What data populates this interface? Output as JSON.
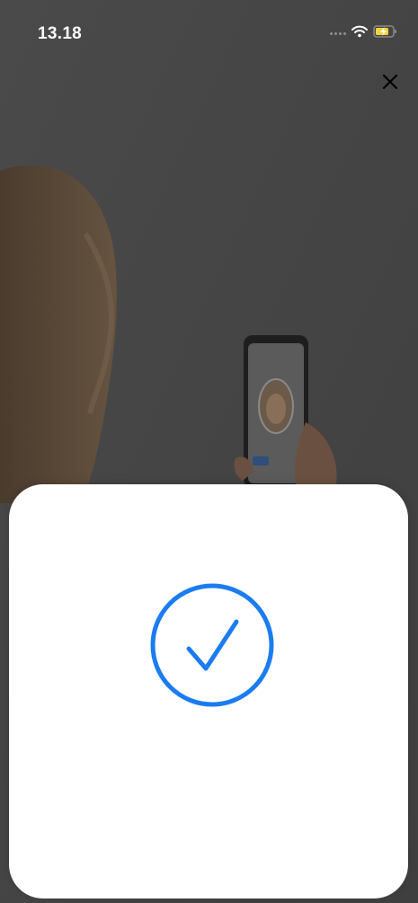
{
  "status_bar": {
    "time": "13.18"
  },
  "icons": {
    "wifi": "wifi-icon",
    "battery": "battery-charging-icon",
    "close": "close-icon",
    "success": "checkmark-circle-icon"
  },
  "colors": {
    "accent": "#1b7cf0",
    "sheet_background": "#ffffff",
    "battery_fill": "#f2d43b"
  },
  "result": {
    "status_text": ""
  }
}
